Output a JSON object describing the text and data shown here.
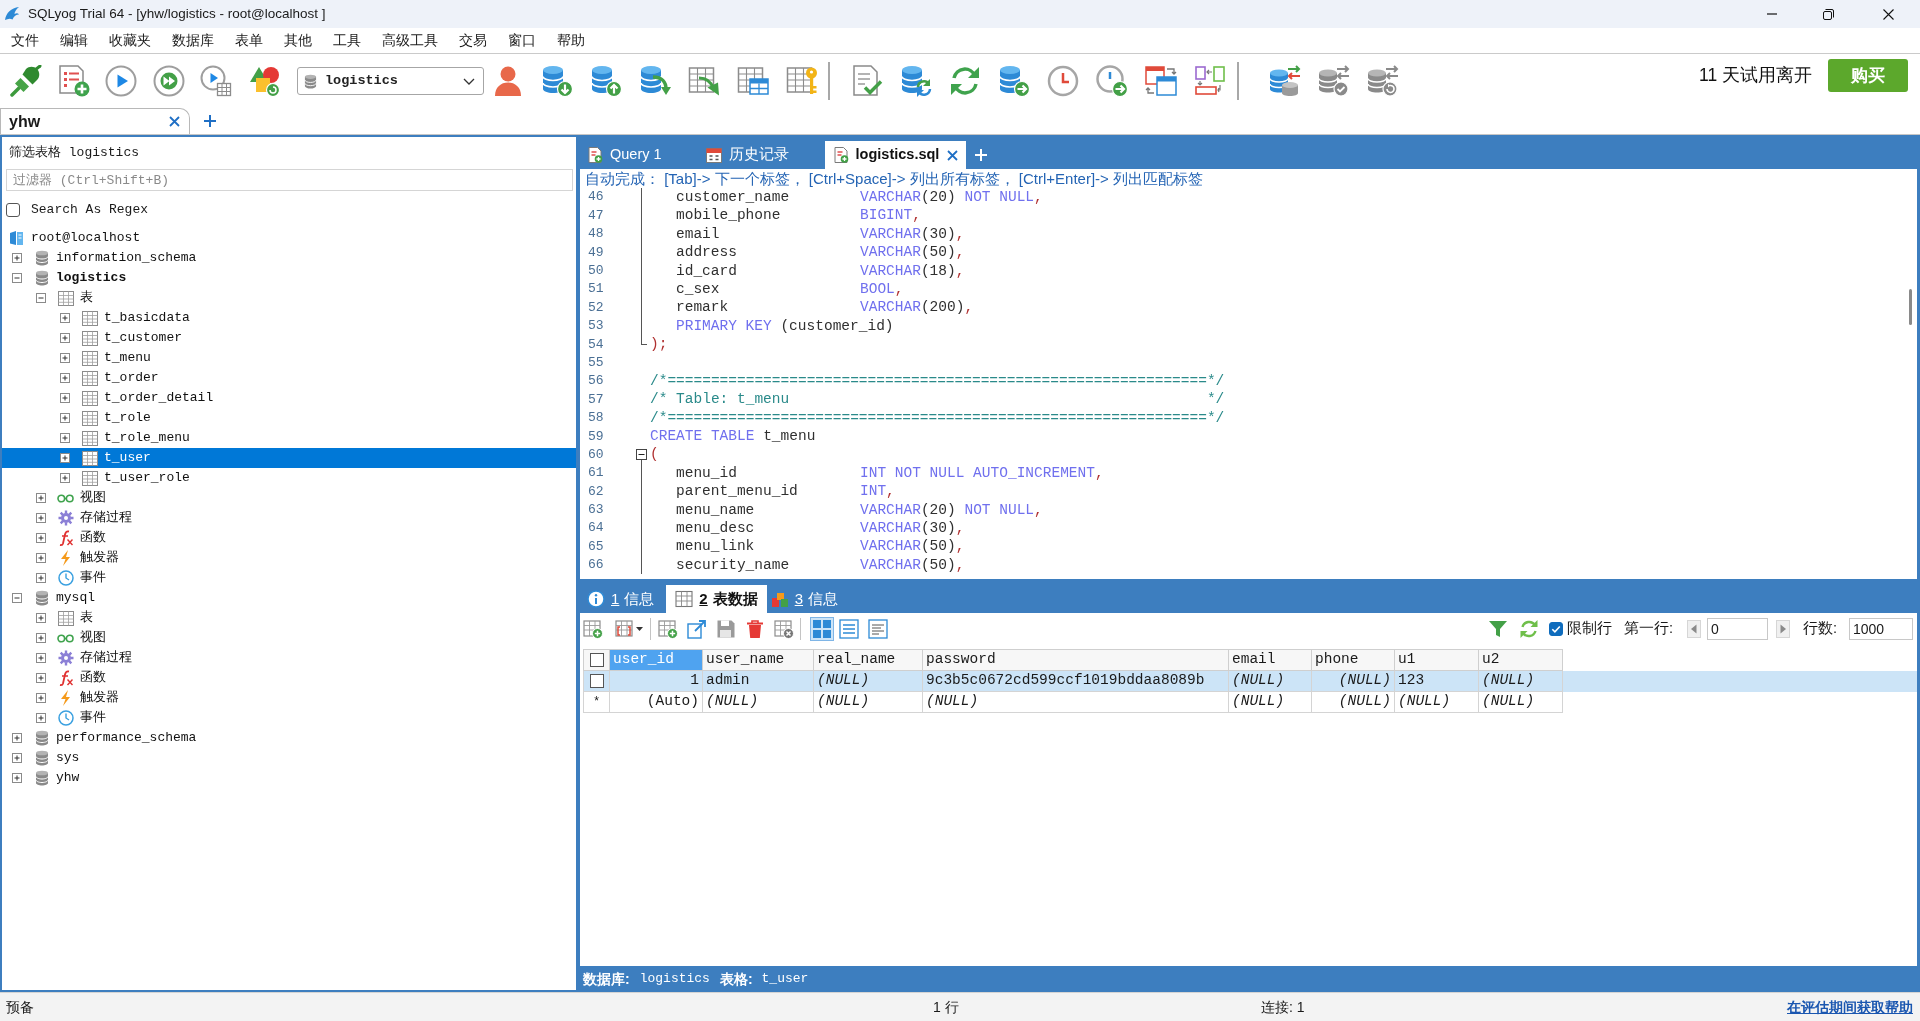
{
  "window": {
    "title": "SQLyog Trial 64 - [yhw/logistics - root@localhost ]"
  },
  "menu": [
    "文件",
    "编辑",
    "收藏夹",
    "数据库",
    "表单",
    "其他",
    "工具",
    "高级工具",
    "交易",
    "窗口",
    "帮助"
  ],
  "toolbar": {
    "database_select": {
      "value": "logistics"
    },
    "trial_notice": "11 天试用离开",
    "buy_button": "购买"
  },
  "connection_tabs": [
    {
      "label": "yhw",
      "selected": true
    }
  ],
  "object_browser": {
    "title": "筛选表格 logistics",
    "filter": {
      "placeholder": "过滤器 (Ctrl+Shift+B)"
    },
    "regex_option": {
      "label": "Search As Regex",
      "checked": false
    },
    "tree": [
      {
        "label": "root@localhost",
        "kind": "connection",
        "selected": false,
        "children": [
          {
            "label": "information_schema",
            "kind": "database",
            "expanded": false,
            "selected": false
          },
          {
            "label": "logistics",
            "kind": "database",
            "expanded": true,
            "current": true,
            "selected": false,
            "children": [
              {
                "label": "表",
                "kind": "tables",
                "expanded": true,
                "selected": false,
                "children": [
                  {
                    "label": "t_basicdata",
                    "kind": "table",
                    "expanded": false,
                    "selected": false
                  },
                  {
                    "label": "t_customer",
                    "kind": "table",
                    "expanded": false,
                    "selected": false
                  },
                  {
                    "label": "t_menu",
                    "kind": "table",
                    "expanded": false,
                    "selected": false
                  },
                  {
                    "label": "t_order",
                    "kind": "table",
                    "expanded": false,
                    "selected": false
                  },
                  {
                    "label": "t_order_detail",
                    "kind": "table",
                    "expanded": false,
                    "selected": false
                  },
                  {
                    "label": "t_role",
                    "kind": "table",
                    "expanded": false,
                    "selected": false
                  },
                  {
                    "label": "t_role_menu",
                    "kind": "table",
                    "expanded": false,
                    "selected": false
                  },
                  {
                    "label": "t_user",
                    "kind": "table",
                    "expanded": false,
                    "selected": true
                  },
                  {
                    "label": "t_user_role",
                    "kind": "table",
                    "expanded": false,
                    "selected": false
                  }
                ]
              },
              {
                "label": "视图",
                "kind": "views",
                "expanded": false,
                "selected": false
              },
              {
                "label": "存储过程",
                "kind": "procedures",
                "expanded": false,
                "selected": false
              },
              {
                "label": "函数",
                "kind": "functions",
                "expanded": false,
                "selected": false
              },
              {
                "label": "触发器",
                "kind": "triggers",
                "expanded": false,
                "selected": false
              },
              {
                "label": "事件",
                "kind": "events",
                "expanded": false,
                "selected": false
              }
            ]
          },
          {
            "label": "mysql",
            "kind": "database",
            "expanded": true,
            "selected": false,
            "children": [
              {
                "label": "表",
                "kind": "tables",
                "expanded": false,
                "selected": false
              },
              {
                "label": "视图",
                "kind": "views",
                "expanded": false,
                "selected": false
              },
              {
                "label": "存储过程",
                "kind": "procedures",
                "expanded": false,
                "selected": false
              },
              {
                "label": "函数",
                "kind": "functions",
                "expanded": false,
                "selected": false
              },
              {
                "label": "触发器",
                "kind": "triggers",
                "expanded": false,
                "selected": false
              },
              {
                "label": "事件",
                "kind": "events",
                "expanded": false,
                "selected": false
              }
            ]
          },
          {
            "label": "performance_schema",
            "kind": "database",
            "expanded": false,
            "selected": false
          },
          {
            "label": "sys",
            "kind": "database",
            "expanded": false,
            "selected": false
          },
          {
            "label": "yhw",
            "kind": "database",
            "expanded": false,
            "selected": false
          }
        ]
      }
    ]
  },
  "editor": {
    "tabs": [
      {
        "label": "Query 1",
        "kind": "query",
        "selected": false
      },
      {
        "label": "历史记录",
        "kind": "history",
        "selected": false
      },
      {
        "label": "logistics.sql",
        "kind": "file",
        "selected": true
      }
    ],
    "hint": "自动完成： [Tab]-> 下一个标签， [Ctrl+Space]-> 列出所有标签， [Ctrl+Enter]-> 列出匹配标签",
    "lines": [
      {
        "number": "46",
        "kind": "field",
        "fold_guide": true,
        "column": "customer_name",
        "words": [
          [
            {
              "kind": "keyword",
              "text": "VARCHAR"
            },
            {
              "kind": "plain",
              "text": "(20)"
            }
          ],
          [
            {
              "kind": "keyword",
              "text": "NOT NULL"
            },
            {
              "kind": "punct",
              "text": ","
            }
          ]
        ]
      },
      {
        "number": "47",
        "kind": "field",
        "fold_guide": true,
        "column": "mobile_phone",
        "words": [
          [
            {
              "kind": "keyword",
              "text": "BIGINT"
            },
            {
              "kind": "punct",
              "text": ","
            }
          ]
        ]
      },
      {
        "number": "48",
        "kind": "field",
        "fold_guide": true,
        "column": "email",
        "words": [
          [
            {
              "kind": "keyword",
              "text": "VARCHAR"
            },
            {
              "kind": "plain",
              "text": "(30)"
            },
            {
              "kind": "punct",
              "text": ","
            }
          ]
        ]
      },
      {
        "number": "49",
        "kind": "field",
        "fold_guide": true,
        "column": "address",
        "words": [
          [
            {
              "kind": "keyword",
              "text": "VARCHAR"
            },
            {
              "kind": "plain",
              "text": "(50)"
            },
            {
              "kind": "punct",
              "text": ","
            }
          ]
        ]
      },
      {
        "number": "50",
        "kind": "field",
        "fold_guide": true,
        "column": "id_card",
        "words": [
          [
            {
              "kind": "keyword",
              "text": "VARCHAR"
            },
            {
              "kind": "plain",
              "text": "(18)"
            },
            {
              "kind": "punct",
              "text": ","
            }
          ]
        ]
      },
      {
        "number": "51",
        "kind": "field",
        "fold_guide": true,
        "column": "c_sex",
        "words": [
          [
            {
              "kind": "keyword",
              "text": "BOOL"
            },
            {
              "kind": "punct",
              "text": ","
            }
          ]
        ]
      },
      {
        "number": "52",
        "kind": "field",
        "fold_guide": true,
        "column": "remark",
        "words": [
          [
            {
              "kind": "keyword",
              "text": "VARCHAR"
            },
            {
              "kind": "plain",
              "text": "(200)"
            },
            {
              "kind": "punct",
              "text": ","
            }
          ]
        ]
      },
      {
        "number": "53",
        "kind": "inner",
        "fold_guide": true,
        "words": [
          [
            {
              "kind": "keyword",
              "text": "PRIMARY KEY"
            }
          ],
          [
            {
              "kind": "plain",
              "text": "(customer_id)"
            }
          ]
        ]
      },
      {
        "number": "54",
        "kind": "outer",
        "fold_end": true,
        "words": [
          [
            {
              "kind": "punct",
              "text": ");"
            }
          ]
        ]
      },
      {
        "number": "55",
        "kind": "blank"
      },
      {
        "number": "56",
        "kind": "outer",
        "words": [
          [
            {
              "kind": "comment",
              "text": "/*==============================================================*/"
            }
          ]
        ]
      },
      {
        "number": "57",
        "kind": "outer",
        "words": [
          [
            {
              "kind": "comment",
              "text": "/* Table: t_menu                                                */"
            }
          ]
        ]
      },
      {
        "number": "58",
        "kind": "outer",
        "words": [
          [
            {
              "kind": "comment",
              "text": "/*==============================================================*/"
            }
          ]
        ]
      },
      {
        "number": "59",
        "kind": "outer",
        "words": [
          [
            {
              "kind": "keyword",
              "text": "CREATE TABLE"
            }
          ],
          [
            {
              "kind": "plain",
              "text": "t_menu"
            }
          ]
        ]
      },
      {
        "number": "60",
        "kind": "outer",
        "fold_start": true,
        "words": [
          [
            {
              "kind": "punct",
              "text": "("
            }
          ]
        ]
      },
      {
        "number": "61",
        "kind": "field",
        "fold_guide": true,
        "column": "menu_id",
        "words": [
          [
            {
              "kind": "keyword",
              "text": "INT NOT NULL AUTO_INCREMENT"
            },
            {
              "kind": "punct",
              "text": ","
            }
          ]
        ]
      },
      {
        "number": "62",
        "kind": "field",
        "fold_guide": true,
        "column": "parent_menu_id",
        "words": [
          [
            {
              "kind": "keyword",
              "text": "INT"
            },
            {
              "kind": "punct",
              "text": ","
            }
          ]
        ]
      },
      {
        "number": "63",
        "kind": "field",
        "fold_guide": true,
        "column": "menu_name",
        "words": [
          [
            {
              "kind": "keyword",
              "text": "VARCHAR"
            },
            {
              "kind": "plain",
              "text": "(20)"
            }
          ],
          [
            {
              "kind": "keyword",
              "text": "NOT NULL"
            },
            {
              "kind": "punct",
              "text": ","
            }
          ]
        ]
      },
      {
        "number": "64",
        "kind": "field",
        "fold_guide": true,
        "column": "menu_desc",
        "words": [
          [
            {
              "kind": "keyword",
              "text": "VARCHAR"
            },
            {
              "kind": "plain",
              "text": "(30)"
            },
            {
              "kind": "punct",
              "text": ","
            }
          ]
        ]
      },
      {
        "number": "65",
        "kind": "field",
        "fold_guide": true,
        "column": "menu_link",
        "words": [
          [
            {
              "kind": "keyword",
              "text": "VARCHAR"
            },
            {
              "kind": "plain",
              "text": "(50)"
            },
            {
              "kind": "punct",
              "text": ","
            }
          ]
        ]
      },
      {
        "number": "66",
        "kind": "field",
        "fold_guide": true,
        "column": "security_name",
        "words": [
          [
            {
              "kind": "keyword",
              "text": "VARCHAR"
            },
            {
              "kind": "plain",
              "text": "(50)"
            },
            {
              "kind": "punct",
              "text": ","
            }
          ]
        ]
      }
    ]
  },
  "results": {
    "tabs": [
      {
        "number": "1",
        "label": "信息",
        "kind": "info",
        "selected": false
      },
      {
        "number": "2",
        "label": "表数据",
        "kind": "table",
        "selected": true
      },
      {
        "number": "3",
        "label": "信息",
        "kind": "profile",
        "selected": false
      }
    ],
    "views": [
      {
        "kind": "grid",
        "selected": true
      },
      {
        "kind": "form",
        "selected": false
      },
      {
        "kind": "text",
        "selected": false
      }
    ],
    "limit_rows": {
      "label": "限制行",
      "checked": true
    },
    "first_row": {
      "label": "第一行:",
      "value": "0"
    },
    "row_count": {
      "label": "行数:",
      "value": "1000"
    },
    "table": {
      "select_all": {
        "checked": false
      },
      "columns": [
        {
          "label": "user_id",
          "numeric": true,
          "selected": true
        },
        {
          "label": "user_name",
          "numeric": false,
          "selected": false
        },
        {
          "label": "real_name",
          "numeric": false,
          "selected": false
        },
        {
          "label": "password",
          "numeric": false,
          "selected": false
        },
        {
          "label": "email",
          "numeric": false,
          "selected": false
        },
        {
          "label": "phone",
          "numeric": true,
          "selected": false
        },
        {
          "label": "u1",
          "numeric": false,
          "selected": false
        },
        {
          "label": "u2",
          "numeric": false,
          "selected": false
        }
      ],
      "rows": [
        {
          "kind": "record",
          "checked": false,
          "selected": true,
          "cells": [
            {
              "text": "1",
              "null": false
            },
            {
              "text": "admin",
              "null": false
            },
            {
              "text": "(NULL)",
              "null": true
            },
            {
              "text": "9c3b5c0672cd599ccf1019bddaa8089b",
              "null": false
            },
            {
              "text": "(NULL)",
              "null": true
            },
            {
              "text": "(NULL)",
              "null": true
            },
            {
              "text": "123",
              "null": false
            },
            {
              "text": "(NULL)",
              "null": true
            }
          ]
        },
        {
          "kind": "new",
          "marker": "*",
          "selected": false,
          "cells": [
            {
              "text": "(Auto)",
              "null": false
            },
            {
              "text": "(NULL)",
              "null": true
            },
            {
              "text": "(NULL)",
              "null": true
            },
            {
              "text": "(NULL)",
              "null": true
            },
            {
              "text": "(NULL)",
              "null": true
            },
            {
              "text": "(NULL)",
              "null": true
            },
            {
              "text": "(NULL)",
              "null": true
            },
            {
              "text": "(NULL)",
              "null": true
            }
          ]
        }
      ]
    },
    "info_bar": {
      "database_label": "数据库:",
      "database": "logistics",
      "table_label": "表格:",
      "table": "t_user"
    }
  },
  "status_bar": {
    "state": "预备",
    "rows": "1 行",
    "connections": "连接: 1",
    "help_link": "在评估期间获取帮助"
  }
}
